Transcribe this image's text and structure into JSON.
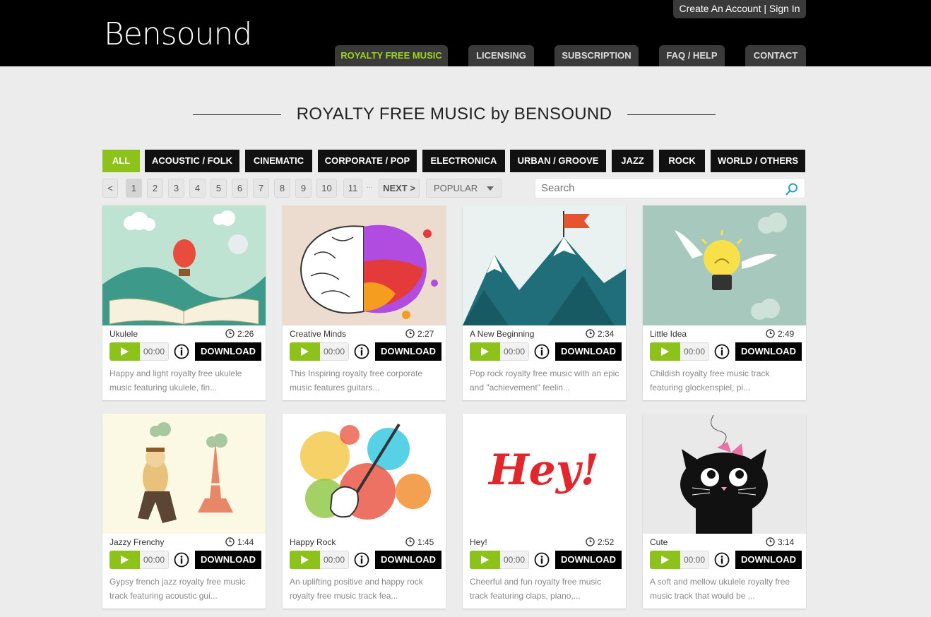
{
  "header": {
    "logo": "Bensound",
    "account_link": "Create An Account | Sign In",
    "nav": [
      {
        "label": "ROYALTY FREE MUSIC",
        "active": true
      },
      {
        "label": "LICENSING"
      },
      {
        "label": "SUBSCRIPTION"
      },
      {
        "label": "FAQ / HELP"
      },
      {
        "label": "CONTACT"
      }
    ]
  },
  "main": {
    "title": "ROYALTY FREE MUSIC by BENSOUND",
    "genres": [
      {
        "label": "ALL",
        "active": true
      },
      {
        "label": "ACOUSTIC / FOLK"
      },
      {
        "label": "CINEMATIC"
      },
      {
        "label": "CORPORATE / POP"
      },
      {
        "label": "ELECTRONICA"
      },
      {
        "label": "URBAN / GROOVE"
      },
      {
        "label": "JAZZ"
      },
      {
        "label": "ROCK"
      },
      {
        "label": "WORLD / OTHERS"
      }
    ],
    "pagination": {
      "prev": "<",
      "pages": [
        "1",
        "2",
        "3",
        "4",
        "5",
        "6",
        "7",
        "8",
        "9",
        "10",
        "11"
      ],
      "current": "1",
      "ellipsis": "...",
      "next": "NEXT >"
    },
    "sort": {
      "selected": "POPULAR"
    },
    "search": {
      "placeholder": "Search"
    }
  },
  "tracks": [
    {
      "title": "Ukulele",
      "duration": "2:26",
      "time": "00:00",
      "download": "DOWNLOAD",
      "description": "Happy and light royalty free ukulele music featuring ukulele, fin..."
    },
    {
      "title": "Creative Minds",
      "duration": "2:27",
      "time": "00:00",
      "download": "DOWNLOAD",
      "description": "This Inspiring royalty free corporate music features guitars..."
    },
    {
      "title": "A New Beginning",
      "duration": "2:34",
      "time": "00:00",
      "download": "DOWNLOAD",
      "description": "Pop rock royalty free music with an epic and \"achievement\" feelin..."
    },
    {
      "title": "Little Idea",
      "duration": "2:49",
      "time": "00:00",
      "download": "DOWNLOAD",
      "description": "Childish royalty free music track featuring glockenspiel, pi..."
    },
    {
      "title": "Jazzy Frenchy",
      "duration": "1:44",
      "time": "00:00",
      "download": "DOWNLOAD",
      "description": "Gypsy french jazz royalty free music track featuring acoustic gui..."
    },
    {
      "title": "Happy Rock",
      "duration": "1:45",
      "time": "00:00",
      "download": "DOWNLOAD",
      "description": "An uplifting positive and happy rock royalty free music track fea..."
    },
    {
      "title": "Hey!",
      "duration": "2:52",
      "time": "00:00",
      "download": "DOWNLOAD",
      "description": "Cheerful and fun royalty free music track featuring claps, piano,...",
      "art_text": "Hey!"
    },
    {
      "title": "Cute",
      "duration": "3:14",
      "time": "00:00",
      "download": "DOWNLOAD",
      "description": "A soft and mellow ukulele royalty free music track that would be ..."
    }
  ],
  "colors": {
    "accent": "#8cc21a",
    "header_bg": "#000000",
    "nav_tab": "#3a3a3a",
    "page_bg": "#ececec"
  }
}
